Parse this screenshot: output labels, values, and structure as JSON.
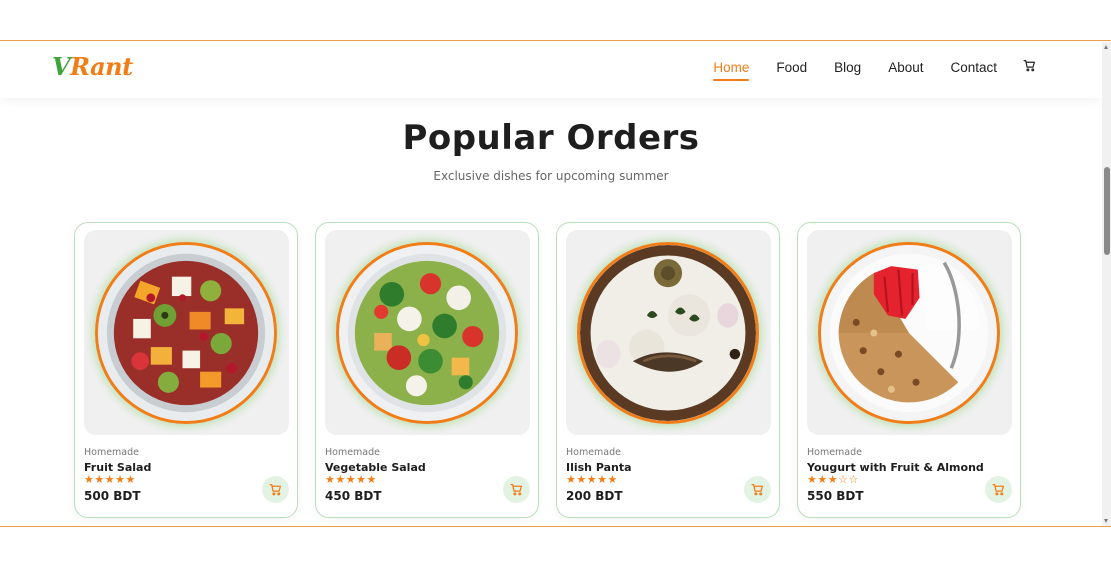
{
  "brand": {
    "logo_initial": "V",
    "logo_rest": "Rant",
    "primary_color": "#f07d18",
    "secondary_color": "#3fa53a"
  },
  "nav": {
    "items": [
      {
        "label": "Home",
        "active": true
      },
      {
        "label": "Food",
        "active": false
      },
      {
        "label": "Blog",
        "active": false
      },
      {
        "label": "About",
        "active": false
      },
      {
        "label": "Contact",
        "active": false
      }
    ],
    "cart_icon": "shopping-cart-icon"
  },
  "section": {
    "title": "Popular Orders",
    "subtitle": "Exclusive dishes for upcoming summer"
  },
  "products": [
    {
      "tag": "Homemade",
      "name": "Fruit Salad",
      "rating": 5,
      "max_rating": 5,
      "price": "500 BDT",
      "image": "fruit-salad-bowl"
    },
    {
      "tag": "Homemade",
      "name": "Vegetable Salad",
      "rating": 5,
      "max_rating": 5,
      "price": "450 BDT",
      "image": "vegetable-salad-bowl"
    },
    {
      "tag": "Homemade",
      "name": "Ilish Panta",
      "rating": 5,
      "max_rating": 5,
      "price": "200 BDT",
      "image": "ilish-panta-plate"
    },
    {
      "tag": "Homemade",
      "name": "Yougurt with Fruit & Almond",
      "rating": 2.5,
      "max_rating": 5,
      "price": "550 BDT",
      "image": "yogurt-granola-bowl"
    }
  ]
}
